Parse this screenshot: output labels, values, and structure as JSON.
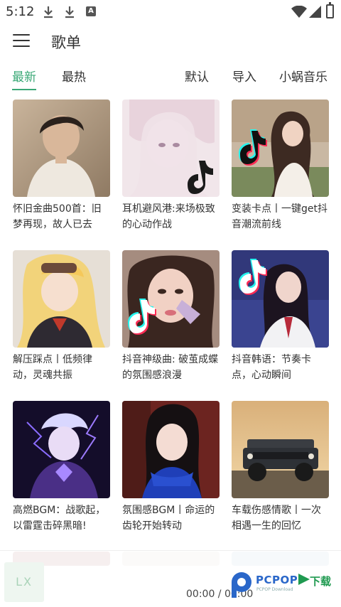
{
  "status_bar": {
    "time": "5:12",
    "icons": [
      "download-icon",
      "download-icon",
      "a-icon",
      "wifi-icon",
      "signal-icon",
      "battery-icon"
    ]
  },
  "app_bar": {
    "title": "歌单"
  },
  "tabs": {
    "latest": "最新",
    "hottest": "最热",
    "default": "默认",
    "import": "导入",
    "source": "小蜗音乐"
  },
  "playlists": [
    {
      "title": "怀旧金曲500首：旧梦再现，故人已去"
    },
    {
      "title": "耳机避风港:来场极致的心动作战"
    },
    {
      "title": "变装卡点丨一键get抖音潮流前线"
    },
    {
      "title": "解压踩点丨低频律动，灵魂共振"
    },
    {
      "title": "抖音神级曲: 破茧成蝶的氛围感浪漫"
    },
    {
      "title": "抖音韩语：节奏卡点，心动瞬间"
    },
    {
      "title": "高燃BGM：战歌起，以雷霆击碎黑暗!"
    },
    {
      "title": "氛围感BGM丨命运的齿轮开始转动"
    },
    {
      "title": "车载伤感情歌丨一次相遇一生的回忆"
    }
  ],
  "player": {
    "logo": "LX",
    "time": "00:00 / 00:00"
  },
  "watermark": {
    "text": "PCPOP",
    "suffix": "下载",
    "sub": "PCPOP Download"
  },
  "colors": {
    "accent": "#3aa876",
    "watermark_blue": "#2a67c9",
    "watermark_green": "#1f9a50"
  }
}
